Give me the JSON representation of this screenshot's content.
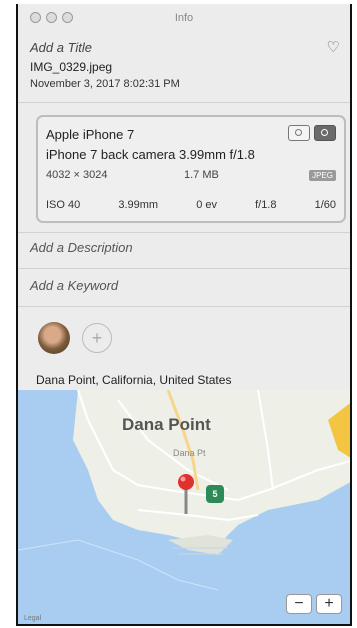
{
  "window": {
    "title": "Info"
  },
  "header": {
    "title_placeholder": "Add a Title",
    "filename": "IMG_0329.jpeg",
    "datetime": "November 3, 2017   8:02:31 PM"
  },
  "camera": {
    "model": "Apple iPhone 7",
    "lens": "iPhone 7 back camera 3.99mm f/1.8",
    "resolution": "4032 × 3024",
    "file_size": "1.7 MB",
    "format": "JPEG",
    "exif": [
      "ISO 40",
      "3.99mm",
      "0 ev",
      "f/1.8",
      "1/60"
    ]
  },
  "description_placeholder": "Add a Description",
  "keyword_placeholder": "Add a Keyword",
  "people": {
    "add_label": "+"
  },
  "location": "Dana Point, California, United States",
  "map": {
    "place_label": "Dana Point",
    "sub_label": "Dana Pt",
    "cluster_count": "5",
    "zoom_out": "−",
    "zoom_in": "+",
    "legal": "Legal"
  },
  "colors": {
    "water": "#a8cdf0",
    "land": "#eef0e8",
    "pin": "#e03030",
    "cluster": "#2e8b57"
  }
}
